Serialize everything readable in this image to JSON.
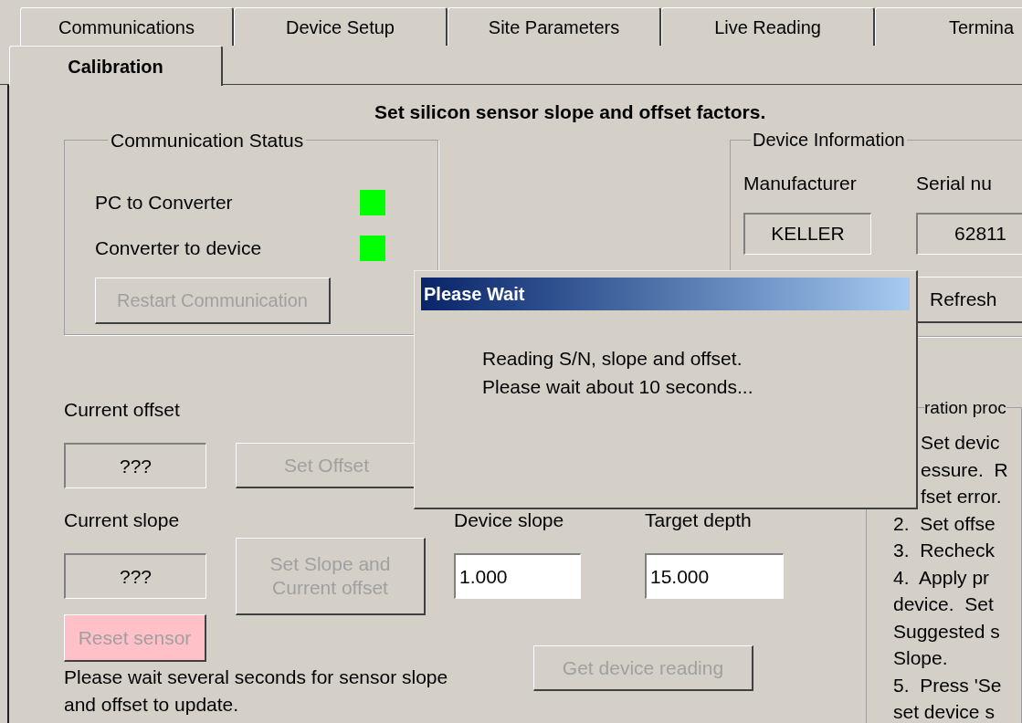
{
  "tab_rows": [
    {
      "tabs": [
        {
          "label": "Communications",
          "selected": false
        },
        {
          "label": "Device Setup",
          "selected": false
        },
        {
          "label": "Site Parameters",
          "selected": false
        },
        {
          "label": "Live Reading",
          "selected": false
        },
        {
          "label": "Termina",
          "selected": false
        }
      ]
    },
    {
      "tabs": [
        {
          "label": "Calibration",
          "selected": true
        }
      ]
    }
  ],
  "heading": "Set silicon sensor slope and offset factors.",
  "communication_status": {
    "title": "Communication Status",
    "links": [
      {
        "label": "PC to Converter",
        "color": "#00ff00"
      },
      {
        "label": "Converter to device",
        "color": "#00ff00"
      }
    ],
    "restart_button": {
      "label": "Restart Communication",
      "disabled": true
    }
  },
  "device_information": {
    "title": "Device Information",
    "columns": [
      {
        "label": "Manufacturer",
        "value": "KELLER"
      },
      {
        "label": "Serial nu",
        "value": "62811"
      }
    ],
    "refresh_button": {
      "label": "Refresh",
      "disabled": false
    }
  },
  "calibration": {
    "current_offset": {
      "label": "Current offset",
      "value": "???"
    },
    "set_offset_button": {
      "label": "Set Offset",
      "disabled": true
    },
    "current_slope": {
      "label": "Current slope",
      "value": "???"
    },
    "set_slope_button": {
      "label": "Set Slope and Current offset",
      "disabled": true
    },
    "device_slope": {
      "label": "Device slope",
      "value": "1.000"
    },
    "target_depth": {
      "label": "Target depth",
      "value": "15.000"
    },
    "reset_button": {
      "label": "Reset sensor",
      "disabled": true,
      "highlighted": true
    },
    "get_reading_button": {
      "label": "Get device reading",
      "disabled": true
    },
    "note": "Please wait several seconds for sensor slope and offset to update."
  },
  "procedure": {
    "title": "ration proc",
    "lines": [
      {
        "text": "Set devic",
        "kind": "partial"
      },
      {
        "text": "essure.  R",
        "kind": "partial"
      },
      {
        "text": "fset error.",
        "kind": "partial"
      },
      {
        "text": "2.  Set offse",
        "kind": "full"
      },
      {
        "text": "3.  Recheck",
        "kind": "full"
      },
      {
        "text": "4.  Apply pr",
        "kind": "full"
      },
      {
        "text": "device.  Set",
        "kind": "full"
      },
      {
        "text": "Suggested s",
        "kind": "full"
      },
      {
        "text": "Slope.",
        "kind": "full"
      },
      {
        "text": "5.  Press 'Se",
        "kind": "full"
      },
      {
        "text": "set device s",
        "kind": "full"
      }
    ]
  },
  "dialog": {
    "title": "Please Wait",
    "lines": [
      "Reading S/N, slope and offset.",
      "Please wait about 10 seconds..."
    ]
  }
}
